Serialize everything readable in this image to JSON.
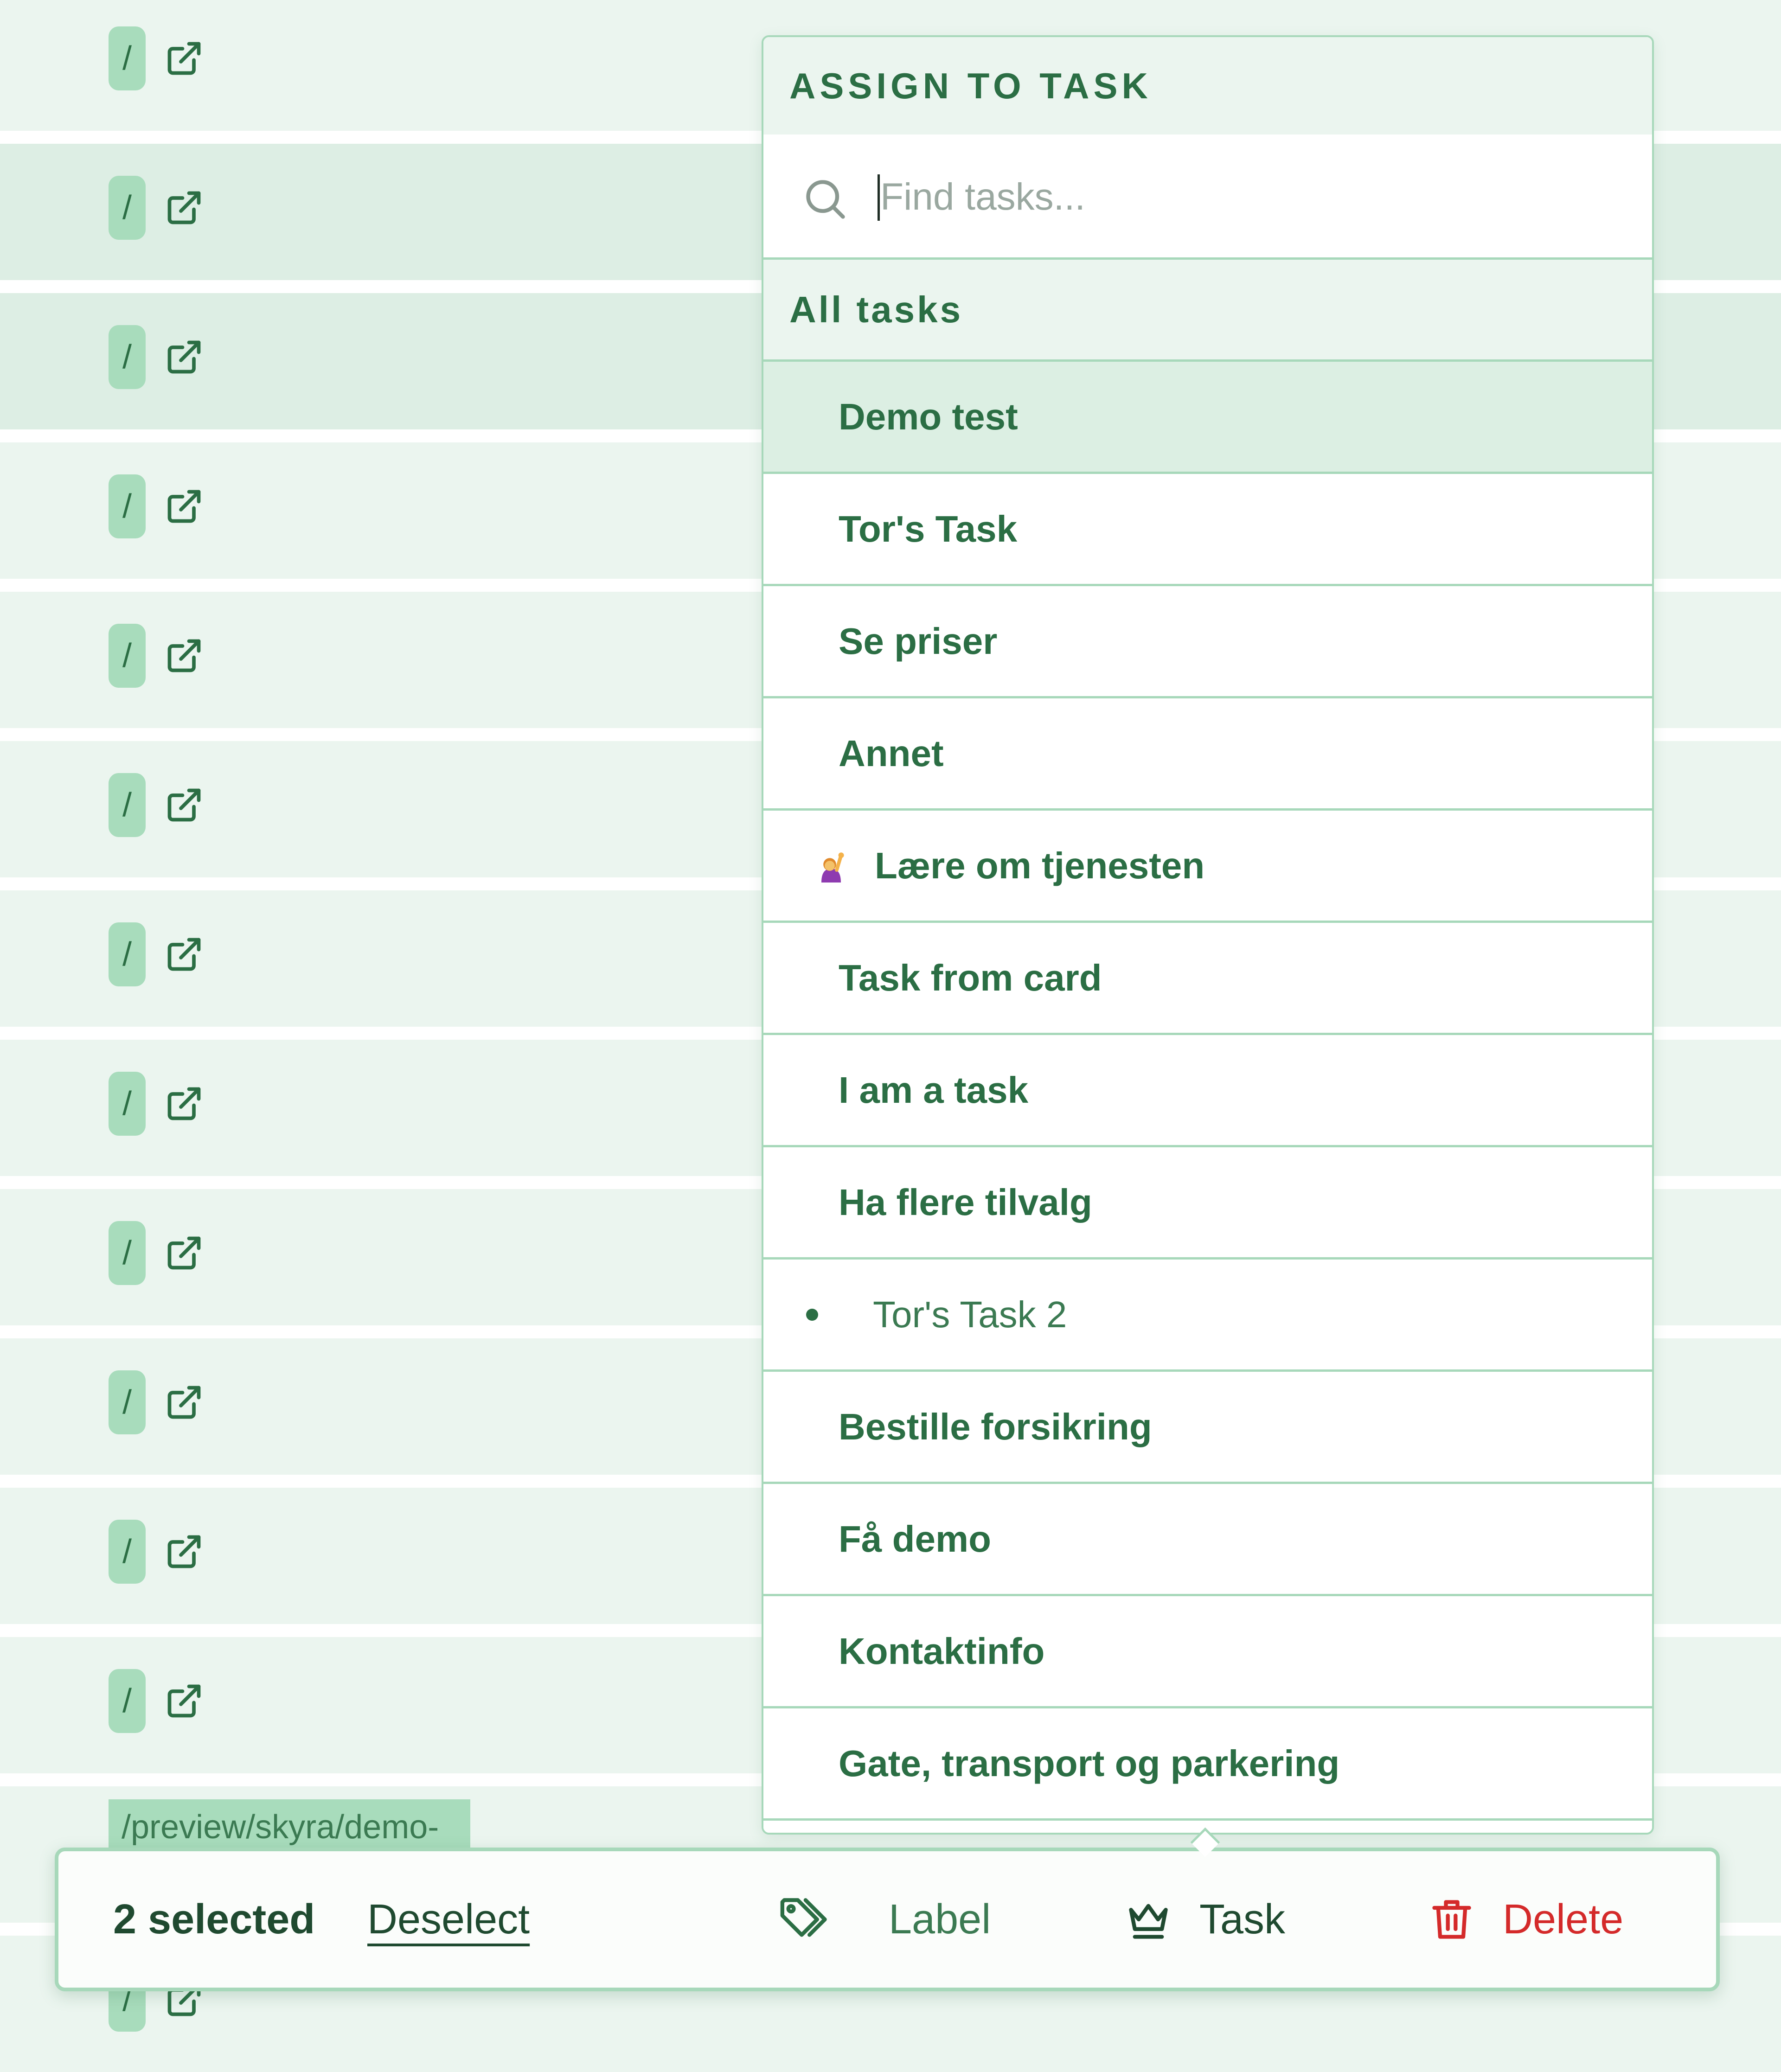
{
  "rows": {
    "path_label": "/",
    "url_snippet": "/preview/skyra/demo-"
  },
  "dropdown": {
    "title": "ASSIGN TO TASK",
    "search": {
      "placeholder": "Find tasks..."
    },
    "section_label": "All tasks",
    "tasks": [
      {
        "label": "Demo test",
        "active": true
      },
      {
        "label": "Tor's Task"
      },
      {
        "label": "Se priser"
      },
      {
        "label": "Annet"
      },
      {
        "label": "Lære om tjenesten",
        "emoji": "person-raising-hand-icon"
      },
      {
        "label": "Task from card"
      },
      {
        "label": "I am a task"
      },
      {
        "label": "Ha flere tilvalg"
      },
      {
        "label": "Tor's Task 2",
        "child": true
      },
      {
        "label": "Bestille forsikring"
      },
      {
        "label": "Få demo"
      },
      {
        "label": "Kontaktinfo"
      },
      {
        "label": "Gate, transport og parkering"
      },
      {
        "label": ""
      }
    ]
  },
  "action_bar": {
    "selected_count": "2 selected",
    "deselect_label": "Deselect",
    "label_button": "Label",
    "task_button": "Task",
    "delete_button": "Delete"
  },
  "colors": {
    "accent_green": "#2b6e44",
    "row_bg": "#ebf5ef",
    "row_highlight": "#ddeee4",
    "chip_bg": "#a8dcbc",
    "border": "#a7d8ba",
    "danger": "#d42a2a"
  }
}
